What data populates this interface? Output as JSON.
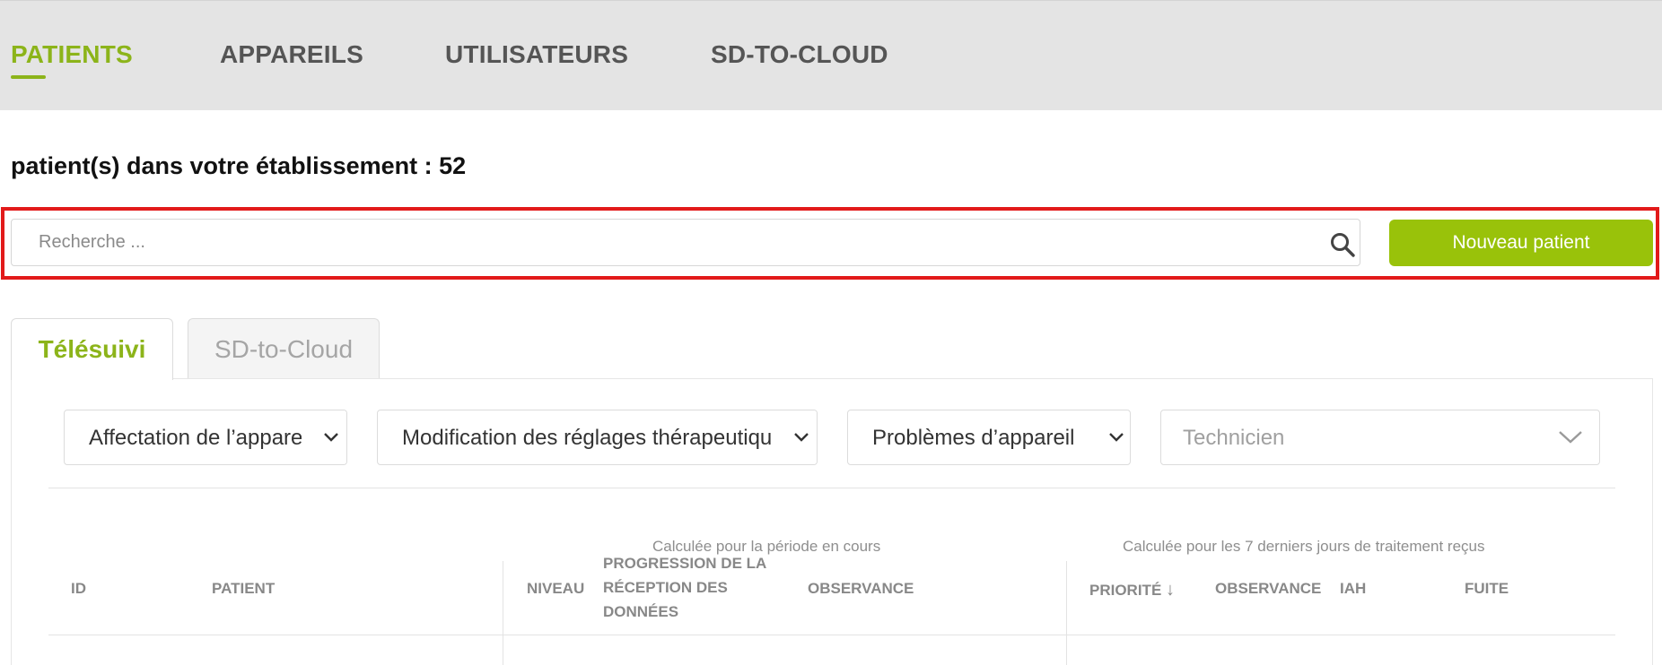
{
  "nav": {
    "items": [
      {
        "label": "PATIENTS"
      },
      {
        "label": "APPAREILS"
      },
      {
        "label": "UTILISATEURS"
      },
      {
        "label": "SD-TO-CLOUD"
      }
    ]
  },
  "heading": {
    "count_text": "patient(s) dans votre établissement : 52"
  },
  "search": {
    "placeholder": "Recherche ...",
    "value": ""
  },
  "actions": {
    "new_patient_label": "Nouveau patient"
  },
  "tabs": [
    {
      "label": "Télésuivi",
      "active": true
    },
    {
      "label": "SD-to-Cloud",
      "active": false
    }
  ],
  "filters": [
    {
      "label": "Affectation de l’appareil"
    },
    {
      "label": "Modification des réglages thérapeutiques"
    },
    {
      "label": "Problèmes d’appareil"
    },
    {
      "label": "Technicien",
      "placeholder": true
    }
  ],
  "table": {
    "group_headers": [
      "Calculée pour la période en cours",
      "Calculée pour les 7 derniers jours de traitement reçus"
    ],
    "columns": [
      "ID",
      "PATIENT",
      "NIVEAU",
      "PROGRESSION DE LA RÉCEPTION DES DONNÉES",
      "OBSERVANCE",
      "PRIORITÉ",
      "OBSERVANCE",
      "IAH",
      "FUITE"
    ],
    "sort_indicator": "↓"
  },
  "colors": {
    "accent": "#8cb41a",
    "button": "#99c20a",
    "highlight": "#e21a1a",
    "nav_bg": "#e4e4e4"
  }
}
